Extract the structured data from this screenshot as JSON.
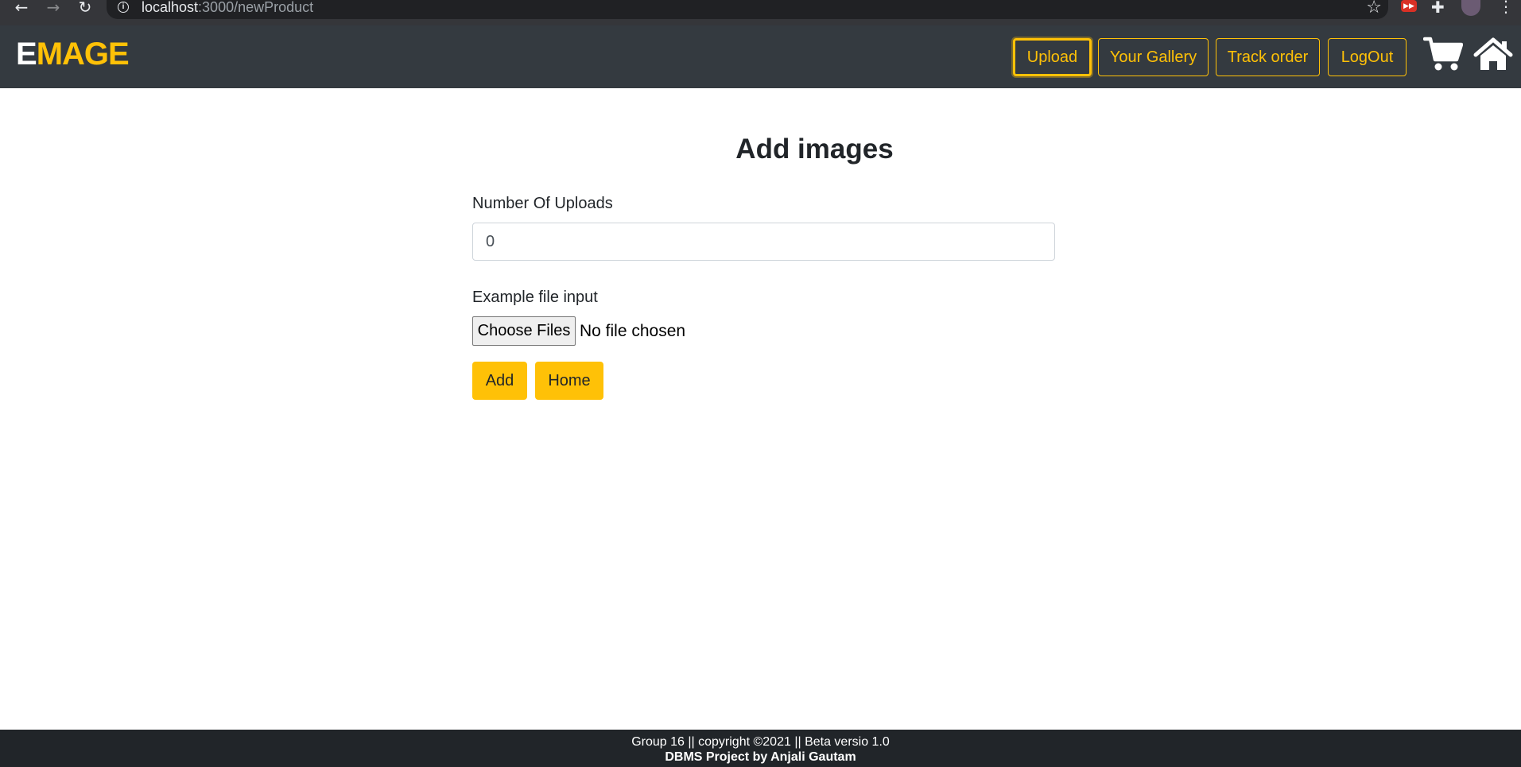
{
  "browser": {
    "url_host": "localhost",
    "url_path": ":3000/newProduct"
  },
  "navbar": {
    "brand_first": "E",
    "brand_rest": "MAGE",
    "links": [
      {
        "label": "Upload",
        "active": true
      },
      {
        "label": "Your Gallery",
        "active": false
      },
      {
        "label": "Track order",
        "active": false
      },
      {
        "label": "LogOut",
        "active": false
      }
    ],
    "icons": [
      "shopping-cart-icon",
      "home-icon"
    ]
  },
  "form": {
    "title": "Add images",
    "uploads_label": "Number Of Uploads",
    "uploads_value": "0",
    "file_label": "Example file input",
    "file_button": "Choose Files",
    "file_status": "No file chosen",
    "add_button": "Add",
    "home_button": "Home"
  },
  "footer": {
    "line1": "Group 16 || copyright ©2021 || Beta versio 1.0",
    "line2": "DBMS Project by Anjali Gautam"
  },
  "colors": {
    "accent": "#ffc107",
    "navbar_bg": "#343a40",
    "footer_bg": "#212529"
  }
}
